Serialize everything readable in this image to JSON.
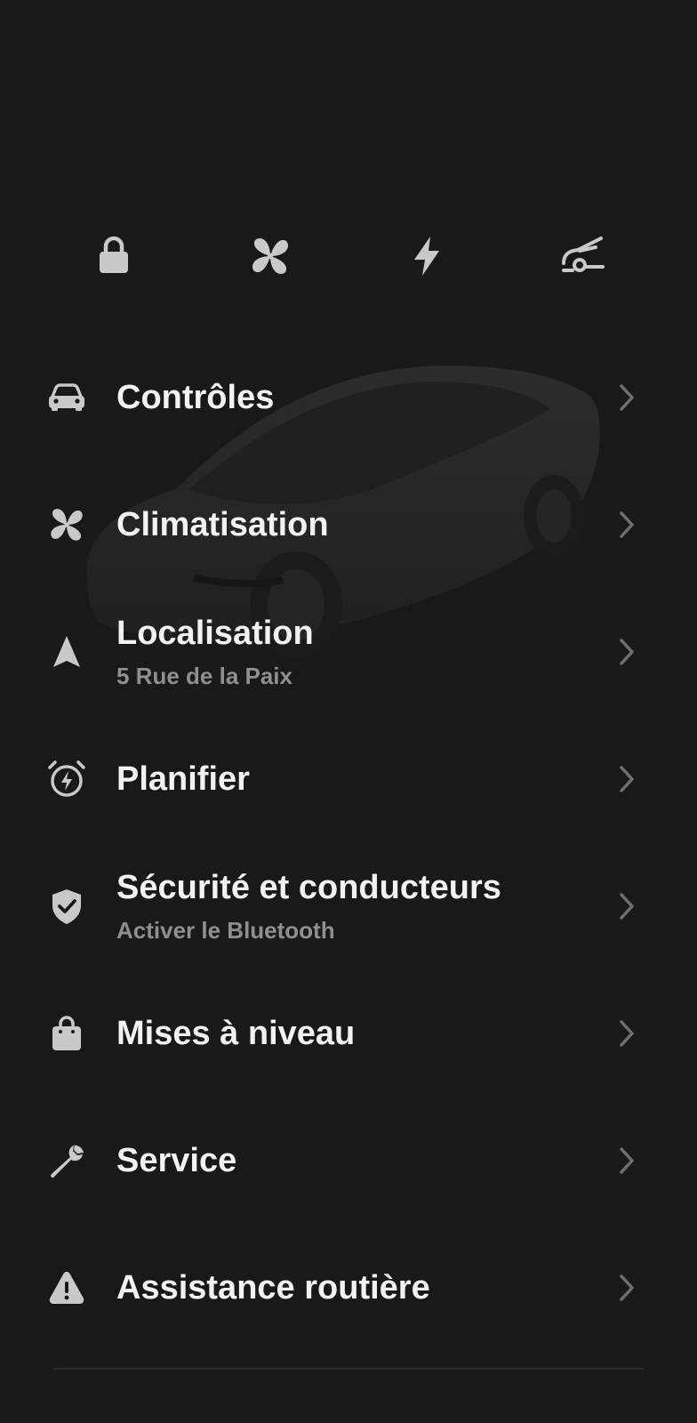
{
  "colors": {
    "background": "#18191b",
    "text_primary": "#f2f2f2",
    "text_secondary": "#8e8f92",
    "icon": "#c9c9cb",
    "chevron": "#6e6f72"
  },
  "quick_actions": [
    {
      "icon": "lock-icon"
    },
    {
      "icon": "fan-icon"
    },
    {
      "icon": "lightning-icon"
    },
    {
      "icon": "trunk-open-icon"
    }
  ],
  "menu": {
    "items": [
      {
        "icon": "car-icon",
        "title": "Contrôles",
        "subtitle": ""
      },
      {
        "icon": "fan-icon",
        "title": "Climatisation",
        "subtitle": ""
      },
      {
        "icon": "navigation-arrow-icon",
        "title": "Localisation",
        "subtitle": "5 Rue de la Paix"
      },
      {
        "icon": "alarm-clock-charge-icon",
        "title": "Planifier",
        "subtitle": ""
      },
      {
        "icon": "shield-check-icon",
        "title": "Sécurité et conducteurs",
        "subtitle": "Activer le Bluetooth"
      },
      {
        "icon": "shopping-bag-icon",
        "title": "Mises à niveau",
        "subtitle": ""
      },
      {
        "icon": "wrench-icon",
        "title": "Service",
        "subtitle": ""
      },
      {
        "icon": "warning-triangle-icon",
        "title": "Assistance routière",
        "subtitle": ""
      }
    ]
  }
}
